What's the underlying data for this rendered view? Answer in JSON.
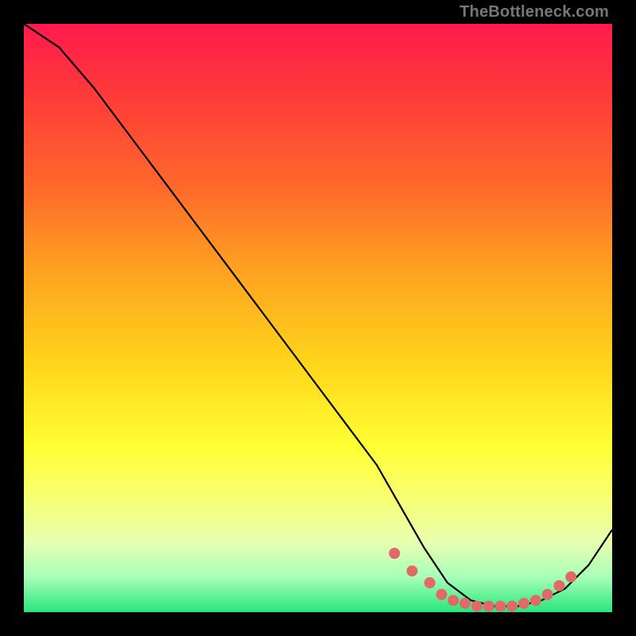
{
  "watermark": "TheBottleneck.com",
  "chart_data": {
    "type": "line",
    "title": "",
    "xlabel": "",
    "ylabel": "",
    "xlim": [
      0,
      100
    ],
    "ylim": [
      0,
      100
    ],
    "series": [
      {
        "name": "curve",
        "x": [
          0,
          6,
          12,
          18,
          24,
          30,
          36,
          42,
          48,
          54,
          60,
          64,
          68,
          72,
          76,
          80,
          84,
          88,
          92,
          96,
          100
        ],
        "y": [
          100,
          96,
          89,
          81,
          73,
          65,
          57,
          49,
          41,
          33,
          25,
          18,
          11,
          5,
          2,
          1,
          1,
          2,
          4,
          8,
          14
        ]
      }
    ],
    "markers": {
      "name": "dots",
      "color": "#e06a6a",
      "x": [
        63,
        66,
        69,
        71,
        73,
        75,
        77,
        79,
        81,
        83,
        85,
        87,
        89,
        91,
        93
      ],
      "y": [
        10,
        7,
        5,
        3,
        2,
        1.5,
        1,
        1,
        1,
        1,
        1.5,
        2,
        3,
        4.5,
        6
      ]
    }
  }
}
